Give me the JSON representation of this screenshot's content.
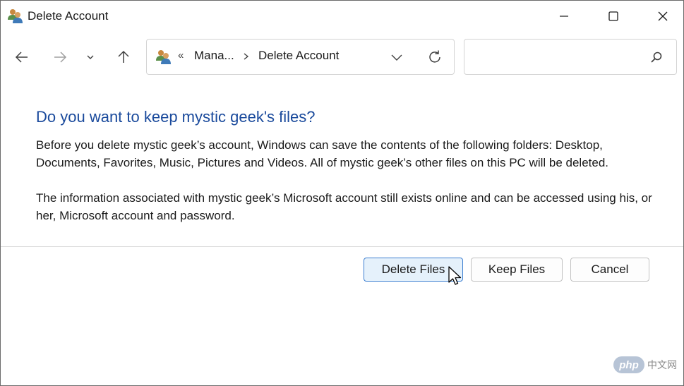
{
  "window": {
    "title": "Delete Account",
    "title_icon": "users-icon"
  },
  "address_bar": {
    "lead_separator": "«",
    "crumbs": [
      "Mana...",
      "Delete Account"
    ],
    "crumb_separator_icon": "chevron-right-icon"
  },
  "search": {
    "placeholder": "",
    "value": ""
  },
  "dialog": {
    "heading": "Do you want to keep mystic geek's files?",
    "paragraph1": "Before you delete mystic geek’s account, Windows can save the contents of the following folders: Desktop, Documents, Favorites, Music, Pictures and Videos. All of mystic geek’s other files on this PC will be deleted.",
    "paragraph2": "The information associated with mystic geek’s Microsoft account still exists online and can be accessed using his, or her, Microsoft account and password."
  },
  "buttons": {
    "delete_files": "Delete Files",
    "keep_files": "Keep Files",
    "cancel": "Cancel"
  },
  "watermark": {
    "logo": "php",
    "text": "中文网"
  },
  "colors": {
    "heading": "#1a4a9c",
    "primary_button_bg": "#e5f1fb",
    "primary_button_border": "#3c7fd1"
  }
}
